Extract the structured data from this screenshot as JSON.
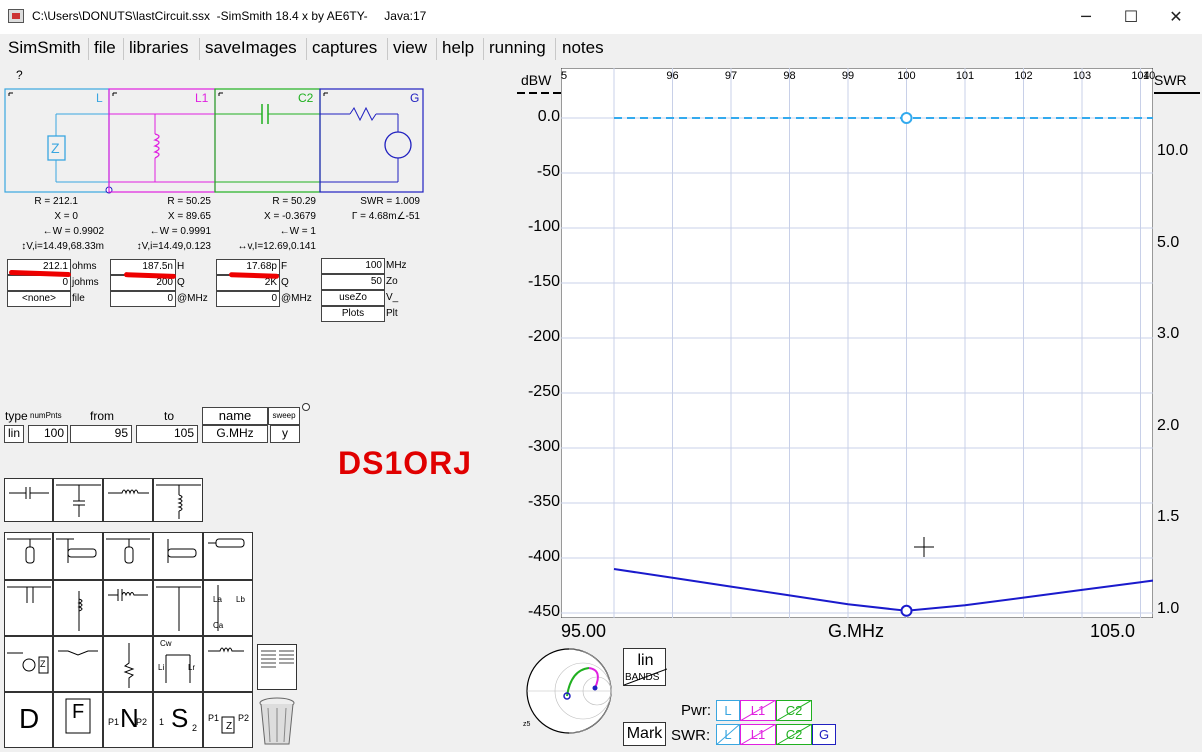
{
  "window": {
    "title": "C:\\Users\\DONUTS\\lastCircuit.ssx  -SimSmith 18.4 x by AE6TY-     Java:17",
    "minimize": "─",
    "maximize": "☐",
    "close": "✕"
  },
  "menu": [
    "SimSmith",
    "file",
    "libraries",
    "saveImages",
    "captures",
    "view",
    "help",
    "running",
    "notes"
  ],
  "help_marker": "?",
  "elements": [
    {
      "id": "L",
      "label": "L",
      "color": "#3aa6e0",
      "R": "R = 212.1",
      "X": "X = 0",
      "W": "←W = 0.9902",
      "VI": "↕V,i=14.49,68.33m"
    },
    {
      "id": "L1",
      "label": "L1",
      "color": "#e020e0",
      "R": "R = 50.25",
      "X": "X = 89.65",
      "W": "←W = 0.9991",
      "VI": "↕V,i=14.49,0.123"
    },
    {
      "id": "C2",
      "label": "C2",
      "color": "#20b020",
      "R": "R = 50.29",
      "X": "X = -0.3679",
      "W": "←W = 1",
      "VI": "↔v,I=12.69,0.141"
    },
    {
      "id": "G",
      "label": "G",
      "color": "#2020c0",
      "R": "SWR = 1.009",
      "X": "Γ = 4.68m∠-51"
    }
  ],
  "params": {
    "L": {
      "v1": "212.1",
      "u1": "ohms",
      "v2": "0",
      "u2": "johms",
      "v3": "<none>",
      "u3": "file"
    },
    "L1": {
      "v1": "187.5n",
      "u1": "H",
      "v2": "200",
      "u2": "Q",
      "v3": "0",
      "u3": "@MHz"
    },
    "C2": {
      "v1": "17.68p",
      "u1": "F",
      "v2": "2K",
      "u2": "Q",
      "v3": "0",
      "u3": "@MHz"
    },
    "G": {
      "v1": "100",
      "u1": "MHz",
      "v2": "50",
      "u2": "Zo",
      "v3": "useZo",
      "u3": "V_",
      "v4": "Plots",
      "u4": "Plt"
    }
  },
  "callsign": "DS1ORJ",
  "sweep": {
    "h_type": "type",
    "h_num": "numPnts",
    "h_from": "from",
    "h_to": "to",
    "h_name": "name",
    "h_sweep": "sweep",
    "type": "lin",
    "num": "100",
    "from": "95",
    "to": "105",
    "name": "G.MHz",
    "sweep_flag": "y"
  },
  "palette": {
    "la": "La",
    "lb": "Lb",
    "ca": "Ca",
    "cw": "Cw",
    "lr": "Lr",
    "li": "Li",
    "z": "Z",
    "p1": "P1",
    "p2": "P2",
    "n1": "1",
    "n2": "2",
    "d": "D",
    "f": "F",
    "n": "N",
    "s": "S"
  },
  "plot": {
    "ylabel": "dBW",
    "swr_label": "SWR",
    "x_center_label": "G.MHz",
    "x_left_label": "95.00",
    "x_right_label": "105.0",
    "grid_color": "#c8d0e8",
    "curve_color": "#1a1acc",
    "dash_color": "#33aaee"
  },
  "chart_data": {
    "type": "line",
    "x_top_ticks": [
      "5",
      "96",
      "97",
      "98",
      "99",
      "100",
      "101",
      "102",
      "103",
      "104",
      "10"
    ],
    "y_ticks": [
      "0.0",
      "-50",
      "-100",
      "-150",
      "-200",
      "-250",
      "-300",
      "-350",
      "-400",
      "-450"
    ],
    "swr_ticks": [
      "10.0",
      "5.0",
      "3.0",
      "2.0",
      "1.5",
      "1.0"
    ],
    "xlim": [
      95,
      105
    ],
    "ylim": [
      -450,
      0
    ],
    "grid": true,
    "series": [
      {
        "x": [
          95,
          96,
          97,
          98,
          99,
          100,
          101,
          102,
          103,
          104,
          105
        ],
        "y": [
          -410,
          -418,
          -426,
          -434,
          -442,
          -448,
          -443,
          -436,
          -429,
          -422,
          -415
        ]
      },
      {
        "x": [
          95,
          105
        ],
        "y": [
          0,
          0
        ]
      }
    ]
  },
  "bottom": {
    "lin": "lin",
    "bands": "BANDS",
    "mark": "Mark",
    "pwr": "Pwr:",
    "swr": "SWR:",
    "pwr_items": [
      "L",
      "L1",
      "C2"
    ],
    "swr_items": [
      "L",
      "L1",
      "C2",
      "G"
    ],
    "smith_small": "z5"
  }
}
